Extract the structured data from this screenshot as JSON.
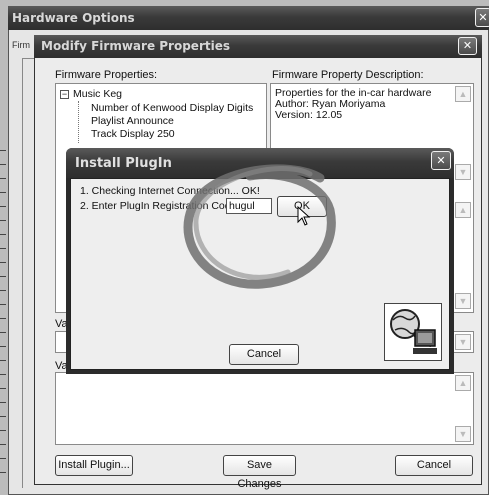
{
  "hardware_options": {
    "title": "Hardware Options",
    "tab_fragment": "Firm",
    "close_glyph": "✕"
  },
  "modify_dialog": {
    "title": "Modify Firmware Properties",
    "close_glyph": "✕",
    "firmware_properties_label": "Firmware Properties:",
    "description_label": "Firmware Property Description:",
    "tree": {
      "root": "Music Keg",
      "children": [
        "Number of Kenwood Display Digits",
        "Playlist Announce",
        "Track Display 250"
      ]
    },
    "description_text": [
      "Properties for the in-car hardware",
      "Author: Ryan Moriyama",
      "Version: 12.05"
    ],
    "value_label_1": "Val",
    "value_label_2": "Val",
    "install_plugin_button": "Install Plugin...",
    "save_changes_button": "Save Changes",
    "cancel_button": "Cancel"
  },
  "install_plugin_dialog": {
    "title": "Install PlugIn",
    "close_glyph": "✕",
    "step1": "1. Checking Internet Connection... OK!",
    "step2_label": "2. Enter PlugIn Registration Code:",
    "code_value": "hugul",
    "ok_button": "OK",
    "cancel_button": "Cancel"
  },
  "colors": {
    "titlebar": "#3a3a3a",
    "dialog_bg": "#ececec",
    "annotation_circle": "#7a7a7a"
  }
}
